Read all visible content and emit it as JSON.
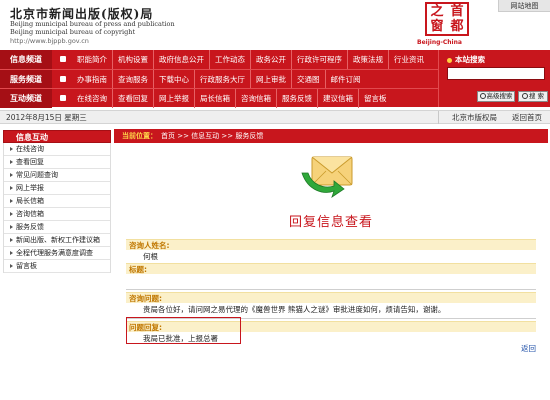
{
  "header": {
    "title_cn": "北京市新闻出版(版权)局",
    "title_en_1": "Beijing municipal bureau of press and publication",
    "title_en_2": "Beijing municipal bureau of copyright",
    "url": "http://www.bjppb.gov.cn",
    "emblem_chars": [
      "之",
      "首",
      "窗",
      "都"
    ],
    "emblem_text": "Beijing-China",
    "site_map": "网站地图"
  },
  "nav": {
    "rows": [
      {
        "label": "信息频道",
        "items": [
          "职能简介",
          "机构设置",
          "政府信息公开",
          "工作动态",
          "政务公开",
          "行政许可程序",
          "政策法规",
          "行业资讯"
        ]
      },
      {
        "label": "服务频道",
        "items": [
          "办事指南",
          "查询服务",
          "下载中心",
          "行政服务大厅",
          "网上审批",
          "交通图",
          "邮件订阅"
        ]
      },
      {
        "label": "互动频道",
        "items": [
          "在线咨询",
          "查看回复",
          "网上举报",
          "局长信箱",
          "咨询信箱",
          "服务反馈",
          "建议信箱",
          "留言板"
        ]
      }
    ]
  },
  "search": {
    "title": "本站搜索",
    "placeholder": "",
    "advanced_label": "高级搜索",
    "search_label": "搜 索"
  },
  "datebar": {
    "date": "2012年8月15日 星期三",
    "home": "北京市版权局",
    "back_home": "返回首页"
  },
  "sidebar": {
    "title": "信息互动",
    "items": [
      "在线咨询",
      "查看回复",
      "常见问题查询",
      "网上举报",
      "局长信箱",
      "咨询信箱",
      "服务反馈",
      "新闻出版、新权工作建议箱",
      "全程代理服务满意度调查",
      "留言板"
    ]
  },
  "main": {
    "location_label": "当前位置：",
    "breadcrumb": "首页 >> 信息互动 >> 服务反馈",
    "reply_title": "回复信息查看",
    "name_label": "咨询人姓名:",
    "name_value": "何根",
    "subject_label": "标题:",
    "subject_value": "",
    "question_label": "咨询问题:",
    "question_value": "贵局各位好，请问网之易代理的《魔兽世界 熊猫人之谜》审批进度如何，烦请告知，谢谢。",
    "reply_label": "问题回复:",
    "reply_value": "我局已批准，上报总署",
    "back_label": "返回"
  }
}
